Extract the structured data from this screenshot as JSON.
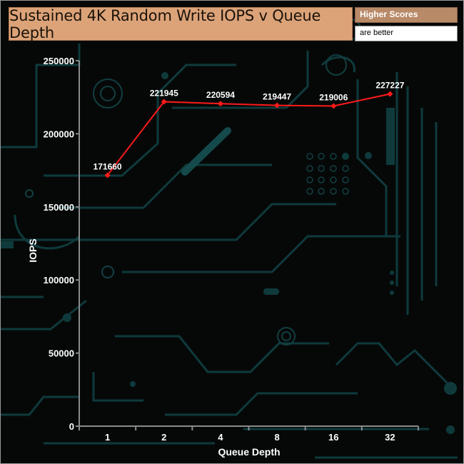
{
  "header": {
    "title": "Sustained 4K Random Write IOPS v Queue Depth",
    "badge_top": "Higher Scores",
    "badge_bottom": "are better"
  },
  "colors": {
    "title_bg": "#dca379",
    "badge_bg": "#b98a68",
    "line": "#ff1a1a",
    "circuit": "#0f3a3c",
    "circuit_bright": "#1a6a6c"
  },
  "chart_data": {
    "type": "line",
    "title": "Sustained 4K Random Write IOPS v Queue Depth",
    "xlabel": "Queue Depth",
    "ylabel": "IOPS",
    "categories": [
      "1",
      "2",
      "4",
      "8",
      "16",
      "32"
    ],
    "series": [
      {
        "values": [
          171660,
          221945,
          220594,
          219447,
          219006,
          227227
        ]
      }
    ],
    "data_labels": [
      "171660",
      "221945",
      "220594",
      "219447",
      "219006",
      "227227"
    ],
    "ylim": [
      0,
      250000
    ],
    "yticks": [
      0,
      50000,
      100000,
      150000,
      200000,
      250000
    ],
    "ytick_labels": [
      "0",
      "50000",
      "100000",
      "150000",
      "200000",
      "250000"
    ],
    "grid": false,
    "legend": "none"
  }
}
